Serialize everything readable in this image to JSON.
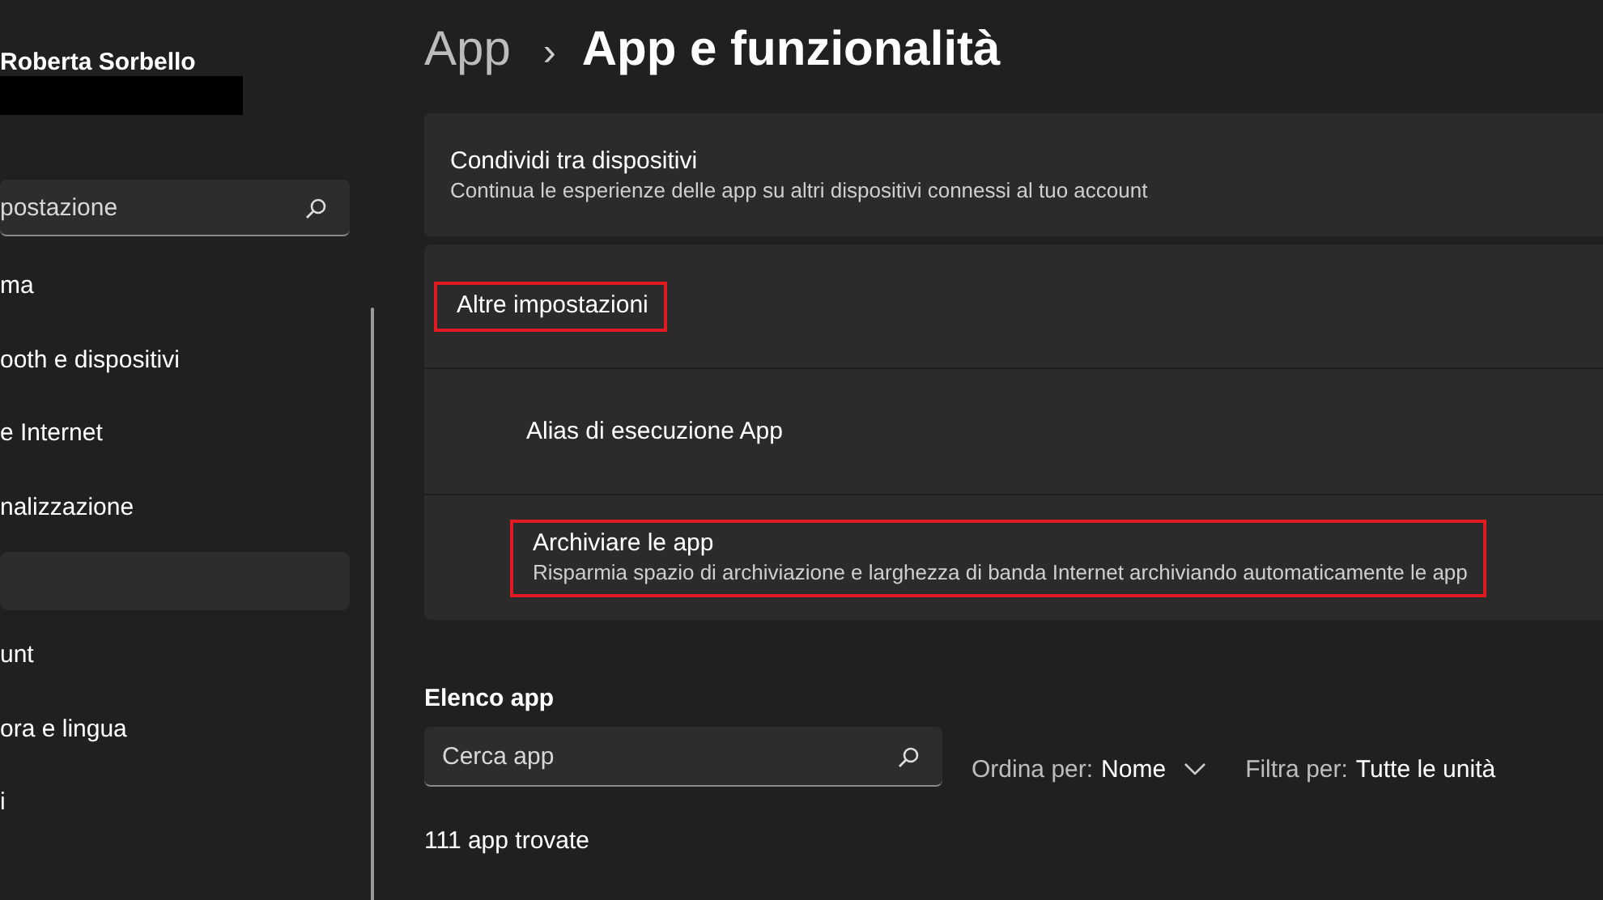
{
  "sidebar": {
    "user_name": "Roberta Sorbello",
    "search": {
      "placeholder": "postazione"
    },
    "items": [
      {
        "label": "ma",
        "selected": false
      },
      {
        "label": "ooth e dispositivi",
        "selected": false
      },
      {
        "label": "e Internet",
        "selected": false
      },
      {
        "label": "nalizzazione",
        "selected": false
      },
      {
        "selected": true
      },
      {
        "label": "unt",
        "selected": false
      },
      {
        "label": "ora e lingua",
        "selected": false
      },
      {
        "label": "i",
        "selected": false
      }
    ]
  },
  "breadcrumb": {
    "parent": "App",
    "separator": "›",
    "current": "App e funzionalità"
  },
  "cards": [
    {
      "title": "Condividi tra dispositivi",
      "description": "Continua le esperienze delle app su altri dispositivi connessi al tuo account",
      "highlighted": false
    },
    {
      "title": "Altre impostazioni",
      "highlighted": true,
      "children": [
        {
          "title": "Alias di esecuzione App",
          "highlighted": false
        },
        {
          "title": "Archiviare le app",
          "description": "Risparmia spazio di archiviazione e larghezza di banda Internet archiviando automaticamente le app",
          "highlighted": true
        }
      ]
    }
  ],
  "app_list": {
    "heading": "Elenco app",
    "search": {
      "placeholder": "Cerca app"
    },
    "sort": {
      "label": "Ordina per:",
      "value": "Nome"
    },
    "filter": {
      "label": "Filtra per:",
      "value": "Tutte le unità"
    },
    "count": "111 app trovate"
  }
}
